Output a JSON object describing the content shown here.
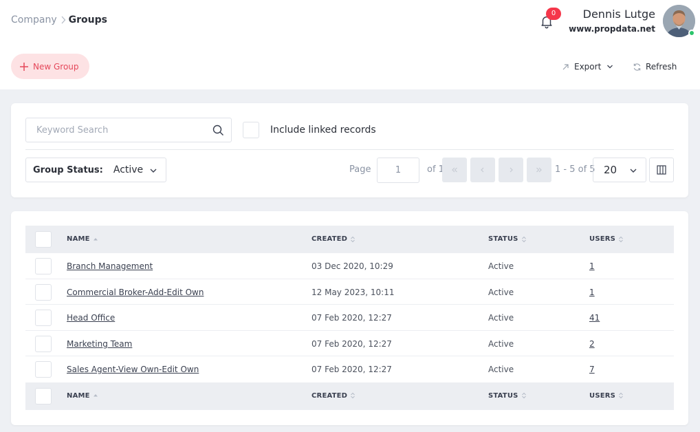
{
  "breadcrumb": {
    "parent": "Company",
    "current": "Groups"
  },
  "notifications": {
    "count": "0"
  },
  "user": {
    "name": "Dennis Lutge",
    "site": "www.propdata.net"
  },
  "actions": {
    "new_group": "New Group",
    "export": "Export",
    "refresh": "Refresh"
  },
  "filters": {
    "search_placeholder": "Keyword Search",
    "include_linked": "Include linked records",
    "status_label": "Group Status:",
    "status_value": "Active"
  },
  "pagination": {
    "page_label": "Page",
    "page_value": "1",
    "of_label": "of 1",
    "range": "1 - 5 of 5",
    "per_page": "20"
  },
  "table": {
    "headers": {
      "name": "NAME",
      "created": "CREATED",
      "status": "STATUS",
      "users": "USERS"
    },
    "rows": [
      {
        "name": "Branch Management",
        "created": "03 Dec 2020, 10:29",
        "status": "Active",
        "users": "1"
      },
      {
        "name": "Commercial Broker-Add-Edit Own",
        "created": "12 May 2023, 10:11",
        "status": "Active",
        "users": "1"
      },
      {
        "name": "Head Office",
        "created": "07 Feb 2020, 12:27",
        "status": "Active",
        "users": "41"
      },
      {
        "name": "Marketing Team",
        "created": "07 Feb 2020, 12:27",
        "status": "Active",
        "users": "2"
      },
      {
        "name": "Sales Agent-View Own-Edit Own",
        "created": "07 Feb 2020, 12:27",
        "status": "Active",
        "users": "7"
      }
    ]
  },
  "colors": {
    "accent": "#e5475a",
    "accent_bg": "#fde2e4",
    "badge": "#f5364a",
    "online": "#2cc46b",
    "header_bg": "#eceef2"
  }
}
